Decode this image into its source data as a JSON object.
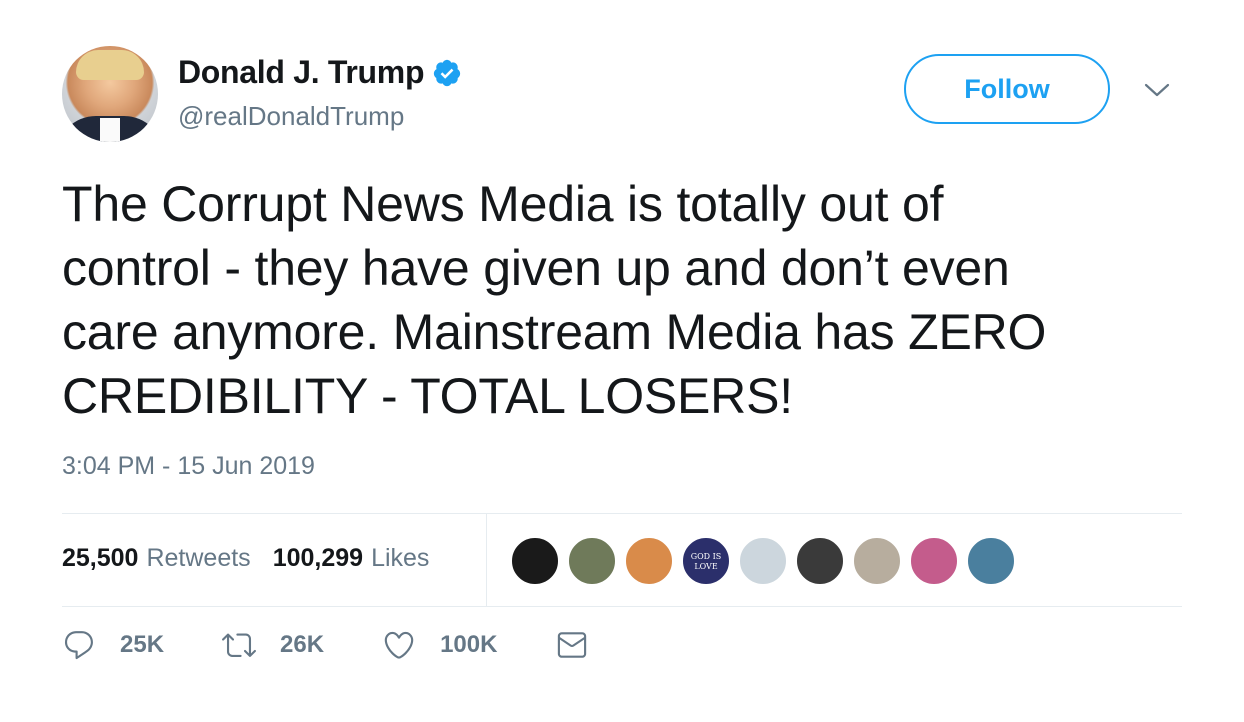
{
  "user": {
    "display_name": "Donald J. Trump",
    "handle": "@realDonaldTrump",
    "verified": true
  },
  "follow_button": {
    "label": "Follow"
  },
  "tweet": {
    "text": "The Corrupt News Media is totally out of\ncontrol - they have given up and don’t even\ncare anymore. Mainstream Media has ZERO\nCREDIBILITY - TOTAL LOSERS!",
    "timestamp": "3:04 PM - 15 Jun 2019"
  },
  "stats": {
    "retweets_count": "25,500",
    "retweets_label": "Retweets",
    "likes_count": "100,299",
    "likes_label": "Likes"
  },
  "liker_avatars": [
    {
      "name": "liker-avatar-1",
      "color": "#1a1a1a"
    },
    {
      "name": "liker-avatar-2",
      "color": "#6f7a5a"
    },
    {
      "name": "liker-avatar-3",
      "color": "#d98b4a"
    },
    {
      "name": "liker-avatar-4",
      "color": "#2b2f6b",
      "text": "GOD IS LOVE"
    },
    {
      "name": "liker-avatar-5",
      "color": "#ccd6dd"
    },
    {
      "name": "liker-avatar-6",
      "color": "#3a3a3a"
    },
    {
      "name": "liker-avatar-7",
      "color": "#b7ad9e"
    },
    {
      "name": "liker-avatar-8",
      "color": "#c45c8c"
    },
    {
      "name": "liker-avatar-9",
      "color": "#4a7f9e"
    }
  ],
  "actions": {
    "reply_count": "25K",
    "retweet_count": "26K",
    "like_count": "100K"
  },
  "colors": {
    "accent": "#1da1f2",
    "secondary_text": "#657786",
    "primary_text": "#14171a"
  },
  "icons": [
    "verified-badge-icon",
    "chevron-down-icon",
    "reply-icon",
    "retweet-icon",
    "like-icon",
    "direct-message-icon"
  ]
}
